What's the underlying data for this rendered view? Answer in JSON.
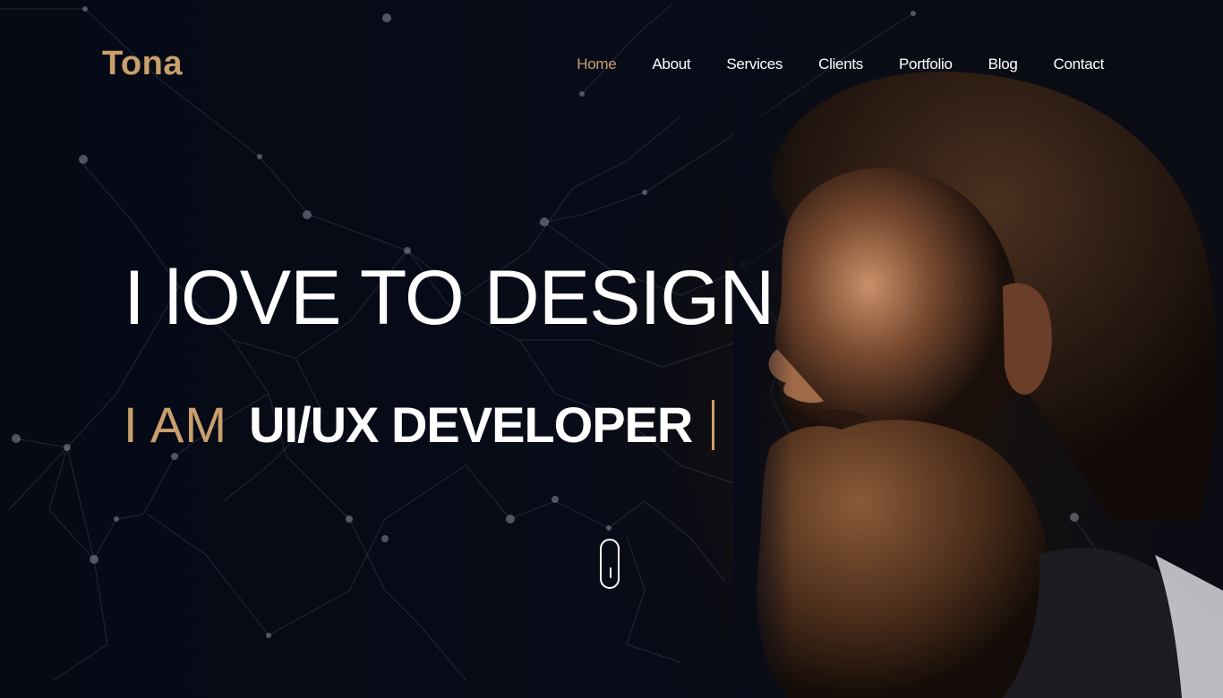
{
  "brand": {
    "logo_text": "Tona",
    "accent_color": "#c9a06d",
    "background_color": "#070b17"
  },
  "nav": {
    "items": [
      {
        "label": "Home",
        "active": true
      },
      {
        "label": "About",
        "active": false
      },
      {
        "label": "Services",
        "active": false
      },
      {
        "label": "Clients",
        "active": false
      },
      {
        "label": "Portfolio",
        "active": false
      },
      {
        "label": "Blog",
        "active": false
      },
      {
        "label": "Contact",
        "active": false
      }
    ]
  },
  "hero": {
    "headline": "I lOVE TO DESIGN",
    "subline_prefix": "I AM",
    "subline_role": "UI/UX DEVELOPER",
    "background_image": "bearded-man-profile-portrait",
    "scroll_indicator_icon": "mouse-scroll-icon"
  }
}
